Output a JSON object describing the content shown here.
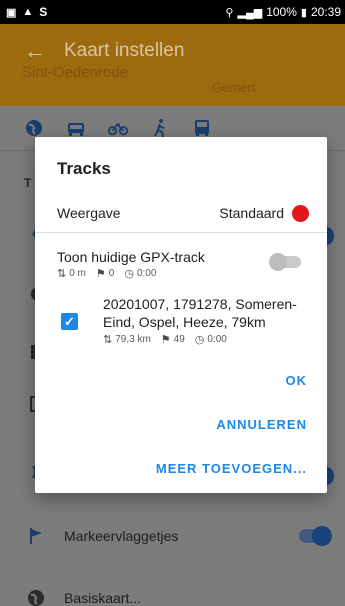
{
  "status_bar": {
    "left": [
      "▣",
      "▲",
      "S"
    ],
    "battery": "100%",
    "time": "20:39"
  },
  "app_bar": {
    "title": "Kaart instellen",
    "map_text_1": "Sint-Oedenrode",
    "map_text_2": "Gemert"
  },
  "background": {
    "section_letter": "T",
    "rows": [
      {
        "label": "Markeervlaggetjes"
      },
      {
        "label": "Basiskaart..."
      }
    ]
  },
  "dialog": {
    "title": "Tracks",
    "weergave_label": "Weergave",
    "weergave_value": "Standaard",
    "weergave_color": "#e5161a",
    "current_gpx": {
      "label": "Toon huidige GPX-track",
      "distance": "0 m",
      "waypoints": "0",
      "duration": "0:00",
      "enabled": false
    },
    "track": {
      "name": "20201007, 1791278, Someren-Eind, Ospel, Heeze, 79km",
      "distance": "79,3 km",
      "waypoints": "49",
      "duration": "0:00",
      "checked": true
    },
    "buttons": {
      "ok": "OK",
      "cancel": "ANNULEREN",
      "add_more": "MEER TOEVOEGEN..."
    }
  },
  "colors": {
    "accent": "#1e88e5",
    "app_bar": "#f0a11a"
  }
}
